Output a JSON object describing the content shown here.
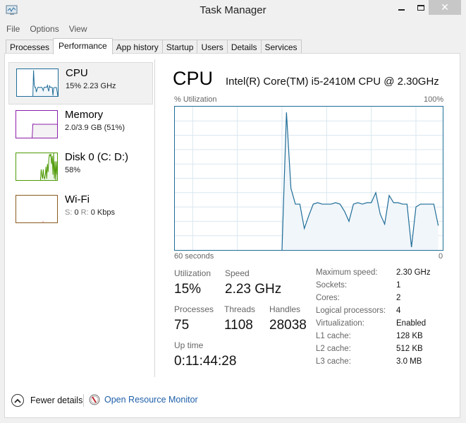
{
  "window": {
    "title": "Task Manager",
    "icon": "task-manager-icon",
    "controls": {
      "minimize": "–",
      "maximize": "□",
      "close": "✕"
    }
  },
  "menu": [
    "File",
    "Options",
    "View"
  ],
  "tabs": [
    {
      "label": "Processes",
      "active": false
    },
    {
      "label": "Performance",
      "active": true
    },
    {
      "label": "App history",
      "active": false
    },
    {
      "label": "Startup",
      "active": false
    },
    {
      "label": "Users",
      "active": false
    },
    {
      "label": "Details",
      "active": false
    },
    {
      "label": "Services",
      "active": false
    }
  ],
  "sidebar": [
    {
      "name": "CPU",
      "sub": "15%  2.23 GHz",
      "color": "#1f6d98",
      "fill": "#f1f6fa",
      "selected": true,
      "history": [
        0,
        0,
        0,
        0,
        0,
        0,
        0,
        0,
        0,
        0,
        0,
        0,
        0,
        0,
        0,
        0,
        0,
        0,
        0,
        0,
        0,
        0,
        0,
        0,
        96,
        43,
        32,
        32,
        15,
        24,
        32,
        33,
        32,
        32,
        32,
        33,
        32,
        27,
        20,
        32,
        33,
        32,
        33,
        33,
        40,
        25,
        18,
        38,
        33,
        33,
        32,
        32,
        2,
        30,
        32,
        32,
        32,
        32,
        17,
        0
      ]
    },
    {
      "name": "Memory",
      "sub": "2.0/3.9 GB (51%)",
      "color": "#8b1fa9",
      "fill": "#f4f2f4",
      "selected": false,
      "history": [
        0,
        0,
        0,
        0,
        0,
        0,
        0,
        0,
        0,
        0,
        0,
        0,
        0,
        0,
        0,
        0,
        0,
        0,
        0,
        0,
        0,
        0,
        0,
        0,
        51,
        51,
        50,
        50,
        50,
        50,
        50,
        50,
        50,
        50,
        50,
        50,
        50,
        50,
        50,
        50,
        50,
        50,
        50,
        50,
        50,
        50,
        50,
        50,
        50,
        50,
        50,
        50,
        50,
        50,
        50,
        50,
        50,
        50,
        50,
        50
      ]
    },
    {
      "name": "Disk 0 (C: D:)",
      "sub": "58%",
      "color": "#4e9a06",
      "fill": "#eef6e8",
      "selected": false,
      "history": [
        0,
        0,
        0,
        0,
        0,
        0,
        0,
        0,
        0,
        0,
        0,
        0,
        0,
        0,
        0,
        0,
        0,
        0,
        0,
        0,
        0,
        0,
        0,
        0,
        0,
        40,
        20,
        5,
        40,
        10,
        5,
        20,
        50,
        5,
        60,
        30,
        80,
        95,
        90,
        98,
        60,
        90,
        20,
        100,
        5,
        70,
        0,
        70,
        20
      ]
    },
    {
      "name": "Wi-Fi",
      "sub_s_label": "S:",
      "sub_s": "0",
      "sub_r_label": "R:",
      "sub_r": "0 Kbps",
      "color": "#8b5a1f",
      "fill": "#fbf6ee",
      "selected": false,
      "history": []
    }
  ],
  "main": {
    "title": "CPU",
    "model": "Intel(R) Core(TM) i5-2410M CPU @ 2.30GHz",
    "graph_top_left": "% Utilization",
    "graph_top_right": "100%",
    "graph_bottom_left": "60 seconds",
    "graph_bottom_right": "0"
  },
  "stats": {
    "utilization_label": "Utilization",
    "utilization": "15%",
    "speed_label": "Speed",
    "speed": "2.23 GHz",
    "processes_label": "Processes",
    "processes": "75",
    "threads_label": "Threads",
    "threads": "1108",
    "handles_label": "Handles",
    "handles": "28038",
    "uptime_label": "Up time",
    "uptime": "0:11:44:28"
  },
  "details": [
    {
      "key": "Maximum speed:",
      "value": "2.30 GHz"
    },
    {
      "key": "Sockets:",
      "value": "1"
    },
    {
      "key": "Cores:",
      "value": "2"
    },
    {
      "key": "Logical processors:",
      "value": "4"
    },
    {
      "key": "Virtualization:",
      "value": "Enabled"
    },
    {
      "key": "L1 cache:",
      "value": "128 KB"
    },
    {
      "key": "L2 cache:",
      "value": "512 KB"
    },
    {
      "key": "L3 cache:",
      "value": "3.0 MB"
    }
  ],
  "footer": {
    "fewer_details": "Fewer details",
    "open_resource_monitor": "Open Resource Monitor"
  },
  "chart_data": {
    "type": "area",
    "title": "CPU % Utilization",
    "xlabel": "60 seconds",
    "ylabel": "% Utilization",
    "ylim": [
      0,
      100
    ],
    "xlim": [
      60,
      0
    ],
    "grid": true,
    "x": [
      60,
      59,
      58,
      57,
      56,
      55,
      54,
      53,
      52,
      51,
      50,
      49,
      48,
      47,
      46,
      45,
      44,
      43,
      42,
      41,
      40,
      39,
      38,
      37,
      36,
      35,
      34,
      33,
      32,
      31,
      30,
      29,
      28,
      27,
      26,
      25,
      24,
      23,
      22,
      21,
      20,
      19,
      18,
      17,
      16,
      15,
      14,
      13,
      12,
      11,
      10,
      9,
      8,
      7,
      6,
      5,
      4,
      3,
      2,
      1,
      0
    ],
    "series": [
      {
        "name": "CPU",
        "values": [
          null,
          null,
          null,
          null,
          null,
          null,
          null,
          null,
          null,
          null,
          null,
          null,
          null,
          null,
          null,
          null,
          null,
          null,
          null,
          null,
          null,
          null,
          null,
          null,
          0,
          96,
          43,
          32,
          32,
          15,
          24,
          32,
          33,
          32,
          32,
          32,
          33,
          32,
          27,
          20,
          32,
          33,
          32,
          33,
          33,
          40,
          25,
          18,
          38,
          33,
          33,
          32,
          32,
          2,
          30,
          32,
          32,
          32,
          32,
          17,
          null
        ]
      }
    ]
  }
}
